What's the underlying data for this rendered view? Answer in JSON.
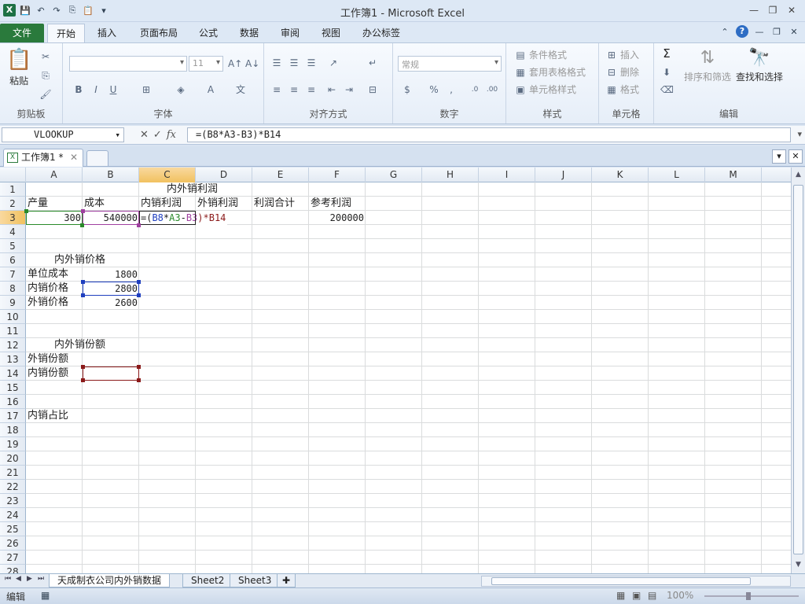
{
  "window": {
    "title": "工作簿1 - Microsoft Excel"
  },
  "ribbon_tabs": [
    "文件",
    "开始",
    "插入",
    "页面布局",
    "公式",
    "数据",
    "审阅",
    "视图",
    "办公标签"
  ],
  "ribbon": {
    "clipboard": {
      "paste": "粘贴",
      "label": "剪贴板"
    },
    "font": {
      "name": "",
      "size": "11",
      "label": "字体"
    },
    "alignment": {
      "label": "对齐方式"
    },
    "number": {
      "format": "常规",
      "label": "数字"
    },
    "styles": {
      "conditional": "条件格式",
      "table": "套用表格格式",
      "cell": "单元格样式",
      "label": "样式"
    },
    "cells": {
      "insert": "插入",
      "delete": "删除",
      "format": "格式",
      "label": "单元格"
    },
    "editing": {
      "sort": "排序和筛选",
      "find": "查找和选择",
      "label": "编辑"
    }
  },
  "formula_bar": {
    "name_box": "VLOOKUP",
    "formula": "=(B8*A3-B3)*B14",
    "fx": "fx"
  },
  "workbook_tabs": {
    "active": "工作簿1 *"
  },
  "columns": [
    "A",
    "B",
    "C",
    "D",
    "E",
    "F",
    "G",
    "H",
    "I",
    "J",
    "K",
    "L",
    "M"
  ],
  "rows": [
    "1",
    "2",
    "3",
    "4",
    "5",
    "6",
    "7",
    "8",
    "9",
    "10",
    "11",
    "12",
    "13",
    "14",
    "15",
    "16",
    "17",
    "18",
    "19",
    "20",
    "21",
    "22",
    "23",
    "24",
    "25",
    "26",
    "27",
    "28"
  ],
  "cells": {
    "C1": "内外销利润",
    "A2": "产量",
    "B2": "成本",
    "C2": "内销利润",
    "D2": "外销利润",
    "E2": "利润合计",
    "F2": "参考利润",
    "A3": "300",
    "B3": "540000",
    "F3": "200000",
    "C3_formula": {
      "p1": "=(",
      "p2": "B8",
      "p3": "*",
      "p4": "A3",
      "p5": "-",
      "p6": "B3",
      "p7": ")*B14"
    },
    "A6": "内外销价格",
    "A7": "单位成本",
    "B7": "1800",
    "A8": "内销价格",
    "B8": "2800",
    "A9": "外销价格",
    "B9": "2600",
    "A12": "内外销份额",
    "A13": "外销份额",
    "A14": "内销份额",
    "A17": "内销占比"
  },
  "sheets": [
    "天成制衣公司内外销数据",
    "Sheet2",
    "Sheet3"
  ],
  "status": {
    "mode": "编辑",
    "zoom": "100%"
  },
  "colors": {
    "ref_B8": "#1f3fbf",
    "ref_A3": "#2a8a2a",
    "ref_B3": "#a040a0",
    "ref_B14": "#8b1a1a"
  }
}
